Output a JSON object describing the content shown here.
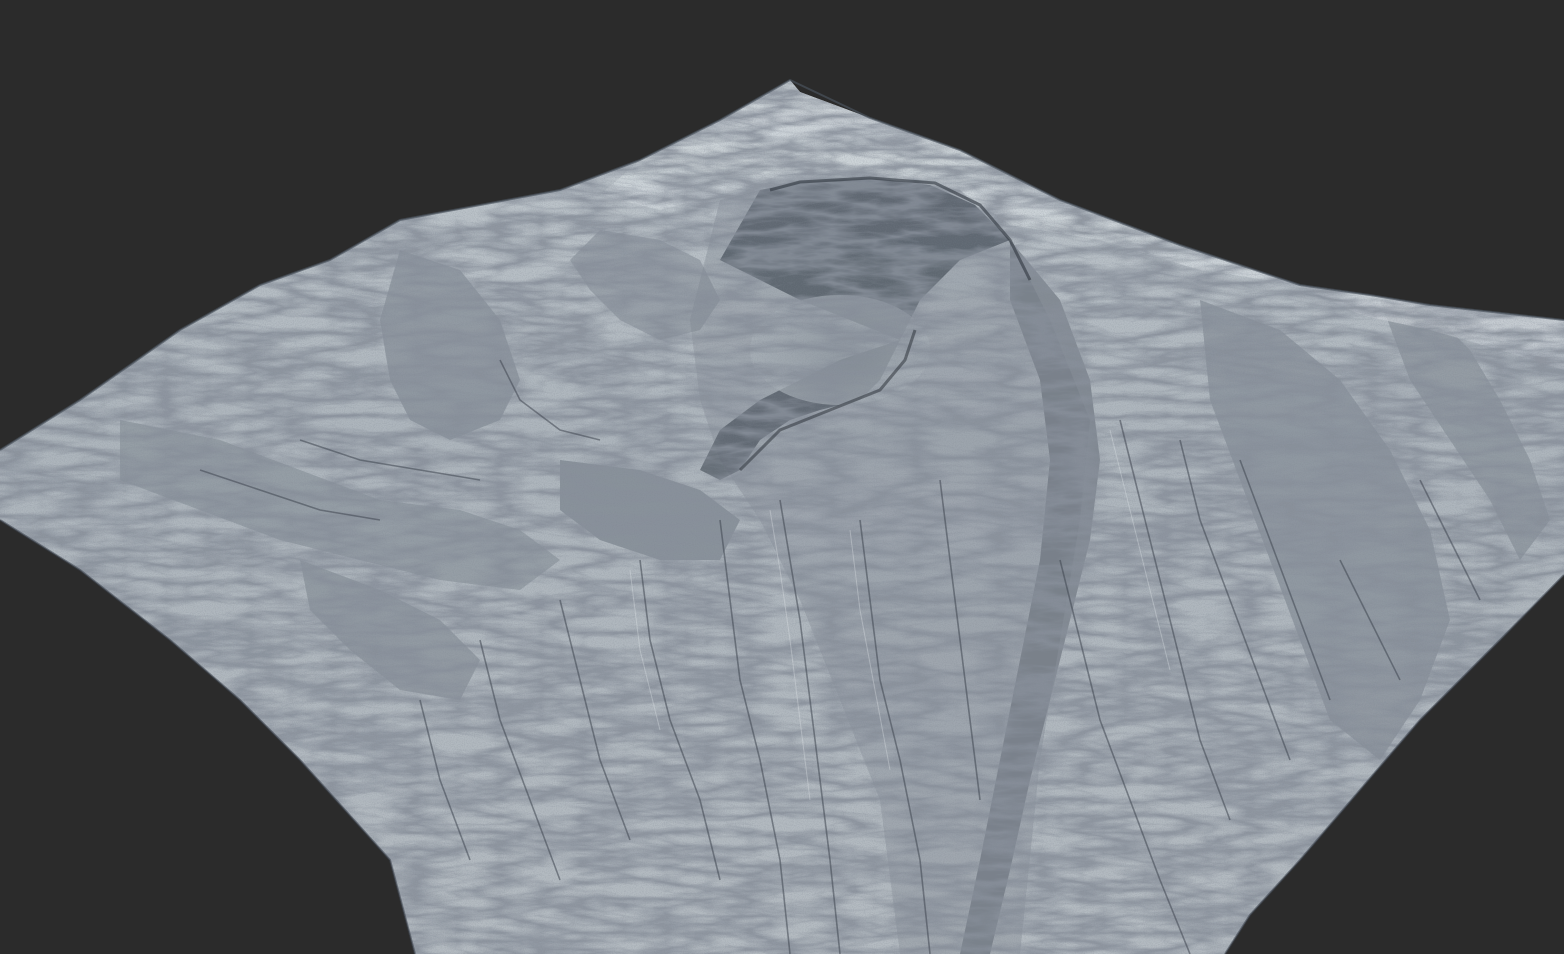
{
  "scene": {
    "background_color": "#2b2b2b",
    "terrain_light_color": "#c2c9cf",
    "terrain_mid_color": "#9aa3ac",
    "terrain_shadow_color": "#4d555f",
    "terrain_deep_shadow_color": "#353b44",
    "subject": "terrain-heightmap-render"
  }
}
